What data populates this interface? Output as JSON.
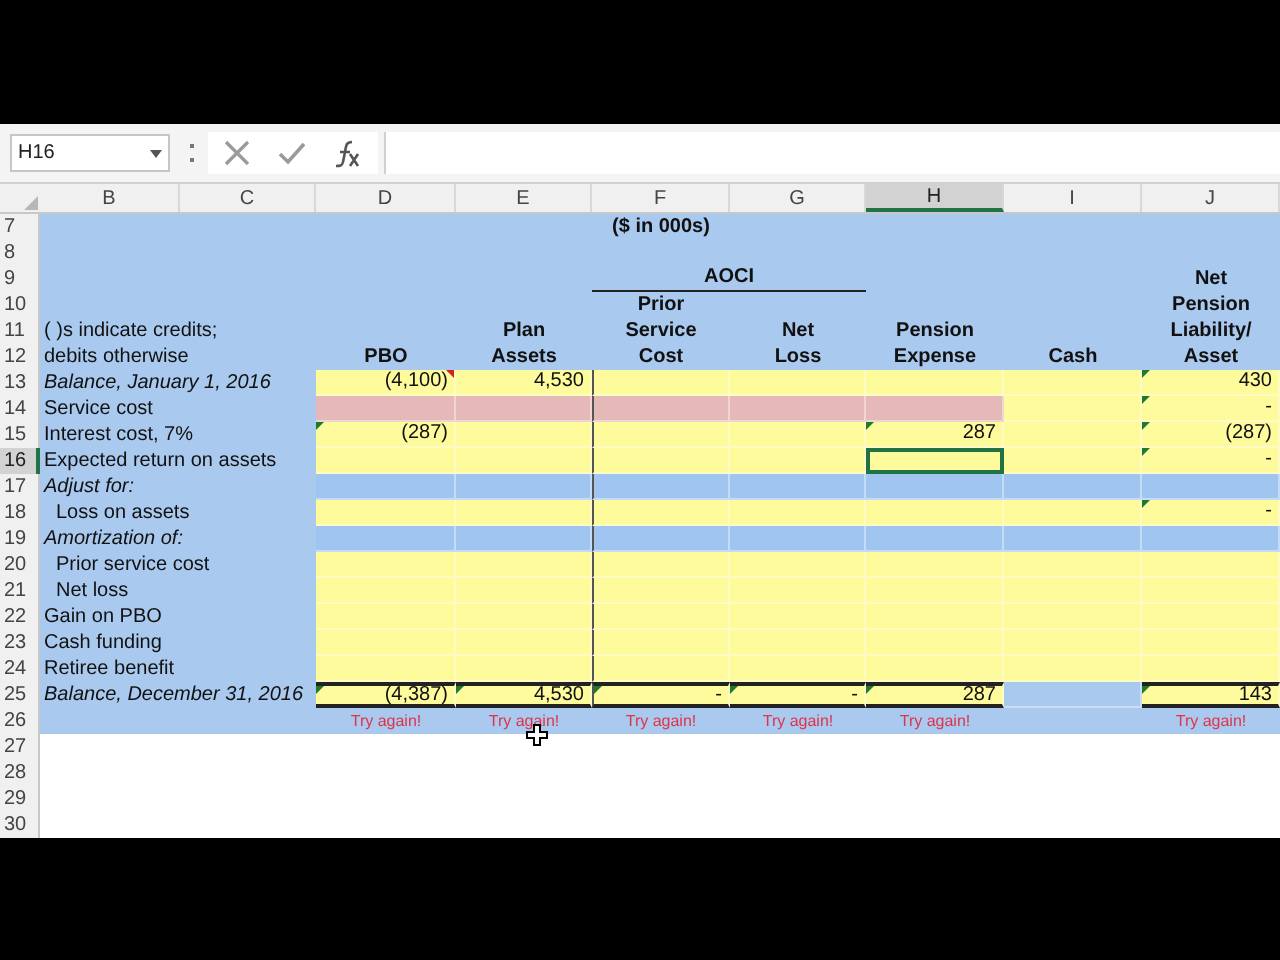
{
  "formula_bar": {
    "name_box": "H16"
  },
  "columns": [
    {
      "letter": "B",
      "selected": false
    },
    {
      "letter": "C",
      "selected": false
    },
    {
      "letter": "D",
      "selected": false
    },
    {
      "letter": "E",
      "selected": false
    },
    {
      "letter": "F",
      "selected": false
    },
    {
      "letter": "G",
      "selected": false
    },
    {
      "letter": "H",
      "selected": true
    },
    {
      "letter": "I",
      "selected": false
    },
    {
      "letter": "J",
      "selected": false
    }
  ],
  "rows": [
    {
      "number": "7",
      "kind": "heading",
      "selected": false,
      "cells": [
        null,
        null,
        {
          "text": "($ in 000s)"
        },
        null,
        null,
        null,
        null
      ]
    },
    {
      "number": "8",
      "kind": "heading",
      "selected": false,
      "cells": [
        null,
        null,
        null,
        null,
        null,
        null,
        null
      ]
    },
    {
      "number": "9",
      "kind": "heading",
      "selected": false,
      "group_heading": {
        "text": "AOCI",
        "underlined": true
      },
      "cells": [
        null,
        null,
        null,
        null,
        null,
        null,
        {
          "text": "Net"
        }
      ]
    },
    {
      "number": "10",
      "kind": "heading",
      "selected": false,
      "cells": [
        null,
        null,
        {
          "text": "Prior"
        },
        null,
        null,
        null,
        {
          "text": "Pension"
        }
      ]
    },
    {
      "number": "11",
      "kind": "heading",
      "selected": false,
      "label": "( )s indicate credits;",
      "cells": [
        null,
        {
          "text": "Plan"
        },
        {
          "text": "Service"
        },
        {
          "text": "Net"
        },
        {
          "text": "Pension"
        },
        null,
        {
          "text": "Liability/"
        }
      ]
    },
    {
      "number": "12",
      "kind": "heading",
      "selected": false,
      "label": "debits otherwise",
      "cells": [
        {
          "text": "PBO"
        },
        {
          "text": "Assets"
        },
        {
          "text": "Cost"
        },
        {
          "text": "Loss"
        },
        {
          "text": "Expense"
        },
        {
          "text": "Cash"
        },
        {
          "text": "Asset"
        }
      ]
    },
    {
      "number": "13",
      "kind": "entry",
      "selected": false,
      "label": "Balance, January 1, 2016",
      "italic": true,
      "indented": false,
      "cells": [
        {
          "text": "(4,100)",
          "color": "#fdfb9c",
          "error_mark": false,
          "comment_mark": true
        },
        {
          "text": "4,530",
          "color": "#fdfb9c",
          "error_mark": false,
          "comment_mark": false
        },
        {
          "color": "#fdfb9c",
          "error_mark": false,
          "comment_mark": false
        },
        {
          "color": "#fdfb9c",
          "error_mark": false,
          "comment_mark": false
        },
        {
          "color": "#fdfb9c",
          "error_mark": false,
          "comment_mark": false
        },
        {
          "color": "#fdfb9c",
          "error_mark": false,
          "comment_mark": false
        },
        {
          "text": "430",
          "color": "#fdfb9c",
          "error_mark": true,
          "comment_mark": false
        }
      ]
    },
    {
      "number": "14",
      "kind": "entry",
      "selected": false,
      "label": "Service cost",
      "italic": false,
      "indented": false,
      "cells": [
        {
          "color": "#e5b9b8",
          "error_mark": false,
          "comment_mark": false
        },
        {
          "color": "#e5b9b8",
          "error_mark": false,
          "comment_mark": false
        },
        {
          "color": "#e5b9b8",
          "error_mark": false,
          "comment_mark": false
        },
        {
          "color": "#e5b9b8",
          "error_mark": false,
          "comment_mark": false
        },
        {
          "color": "#e5b9b8",
          "error_mark": false,
          "comment_mark": false
        },
        {
          "color": "#fdfb9c",
          "error_mark": false,
          "comment_mark": false
        },
        {
          "text": "-",
          "color": "#fdfb9c",
          "error_mark": true,
          "comment_mark": false
        }
      ]
    },
    {
      "number": "15",
      "kind": "entry",
      "selected": false,
      "label": "Interest cost, 7%",
      "italic": false,
      "indented": false,
      "cells": [
        {
          "text": "(287)",
          "color": "#fdfb9c",
          "error_mark": true,
          "comment_mark": false
        },
        {
          "color": "#fdfb9c",
          "error_mark": false,
          "comment_mark": false
        },
        {
          "color": "#fdfb9c",
          "error_mark": false,
          "comment_mark": false
        },
        {
          "color": "#fdfb9c",
          "error_mark": false,
          "comment_mark": false
        },
        {
          "text": "287",
          "color": "#fdfb9c",
          "error_mark": true,
          "comment_mark": false
        },
        {
          "color": "#fdfb9c",
          "error_mark": false,
          "comment_mark": false
        },
        {
          "text": "(287)",
          "color": "#fdfb9c",
          "error_mark": true,
          "comment_mark": false
        }
      ]
    },
    {
      "number": "16",
      "kind": "entry",
      "selected": true,
      "label": "Expected return on assets",
      "italic": false,
      "indented": false,
      "cells": [
        {
          "color": "#fdfb9c",
          "error_mark": false,
          "comment_mark": false
        },
        {
          "color": "#fdfb9c",
          "error_mark": false,
          "comment_mark": false
        },
        {
          "color": "#fdfb9c",
          "error_mark": false,
          "comment_mark": false
        },
        {
          "color": "#fdfb9c",
          "error_mark": false,
          "comment_mark": false
        },
        {
          "color": "#fdfb9c",
          "error_mark": false,
          "comment_mark": false
        },
        {
          "color": "#fdfb9c",
          "error_mark": false,
          "comment_mark": false
        },
        {
          "text": "-",
          "color": "#fdfb9c",
          "error_mark": true,
          "comment_mark": false
        }
      ]
    },
    {
      "number": "17",
      "kind": "entry",
      "selected": false,
      "label": "Adjust for:",
      "italic": true,
      "indented": false,
      "cells": [
        {
          "color": "#9fc5f0",
          "error_mark": false,
          "comment_mark": false
        },
        {
          "color": "#9fc5f0",
          "error_mark": false,
          "comment_mark": false
        },
        {
          "color": "#9fc5f0",
          "error_mark": false,
          "comment_mark": false
        },
        {
          "color": "#9fc5f0",
          "error_mark": false,
          "comment_mark": false
        },
        {
          "color": "#9fc5f0",
          "error_mark": false,
          "comment_mark": false
        },
        {
          "color": "#9fc5f0",
          "error_mark": false,
          "comment_mark": false
        },
        {
          "color": "#9fc5f0",
          "error_mark": false,
          "comment_mark": false
        }
      ]
    },
    {
      "number": "18",
      "kind": "entry",
      "selected": false,
      "label": "Loss on assets",
      "italic": false,
      "indented": true,
      "cells": [
        {
          "color": "#fdfb9c",
          "error_mark": false,
          "comment_mark": false
        },
        {
          "color": "#fdfb9c",
          "error_mark": false,
          "comment_mark": false
        },
        {
          "color": "#fdfb9c",
          "error_mark": false,
          "comment_mark": false
        },
        {
          "color": "#fdfb9c",
          "error_mark": false,
          "comment_mark": false
        },
        {
          "color": "#fdfb9c",
          "error_mark": false,
          "comment_mark": false
        },
        {
          "color": "#fdfb9c",
          "error_mark": false,
          "comment_mark": false
        },
        {
          "text": "-",
          "color": "#fdfb9c",
          "error_mark": true,
          "comment_mark": false
        }
      ]
    },
    {
      "number": "19",
      "kind": "entry",
      "selected": false,
      "label": "Amortization of:",
      "italic": true,
      "indented": false,
      "cells": [
        {
          "color": "#9fc5f0",
          "error_mark": false,
          "comment_mark": false
        },
        {
          "color": "#9fc5f0",
          "error_mark": false,
          "comment_mark": false
        },
        {
          "color": "#9fc5f0",
          "error_mark": false,
          "comment_mark": false
        },
        {
          "color": "#9fc5f0",
          "error_mark": false,
          "comment_mark": false
        },
        {
          "color": "#9fc5f0",
          "error_mark": false,
          "comment_mark": false
        },
        {
          "color": "#9fc5f0",
          "error_mark": false,
          "comment_mark": false
        },
        {
          "color": "#9fc5f0",
          "error_mark": false,
          "comment_mark": false
        }
      ]
    },
    {
      "number": "20",
      "kind": "entry",
      "selected": false,
      "label": "Prior service cost",
      "italic": false,
      "indented": true,
      "cells": [
        {
          "color": "#fdfb9c",
          "error_mark": false,
          "comment_mark": false
        },
        {
          "color": "#fdfb9c",
          "error_mark": false,
          "comment_mark": false
        },
        {
          "color": "#fdfb9c",
          "error_mark": false,
          "comment_mark": false
        },
        {
          "color": "#fdfb9c",
          "error_mark": false,
          "comment_mark": false
        },
        {
          "color": "#fdfb9c",
          "error_mark": false,
          "comment_mark": false
        },
        {
          "color": "#fdfb9c",
          "error_mark": false,
          "comment_mark": false
        },
        {
          "color": "#fdfb9c",
          "error_mark": false,
          "comment_mark": false
        }
      ]
    },
    {
      "number": "21",
      "kind": "entry",
      "selected": false,
      "label": "Net loss",
      "italic": false,
      "indented": true,
      "cells": [
        {
          "color": "#fdfb9c",
          "error_mark": false,
          "comment_mark": false
        },
        {
          "color": "#fdfb9c",
          "error_mark": false,
          "comment_mark": false
        },
        {
          "color": "#fdfb9c",
          "error_mark": false,
          "comment_mark": false
        },
        {
          "color": "#fdfb9c",
          "error_mark": false,
          "comment_mark": false
        },
        {
          "color": "#fdfb9c",
          "error_mark": false,
          "comment_mark": false
        },
        {
          "color": "#fdfb9c",
          "error_mark": false,
          "comment_mark": false
        },
        {
          "color": "#fdfb9c",
          "error_mark": false,
          "comment_mark": false
        }
      ]
    },
    {
      "number": "22",
      "kind": "entry",
      "selected": false,
      "label": "Gain on PBO",
      "italic": false,
      "indented": false,
      "cells": [
        {
          "color": "#fdfb9c",
          "error_mark": false,
          "comment_mark": false
        },
        {
          "color": "#fdfb9c",
          "error_mark": false,
          "comment_mark": false
        },
        {
          "color": "#fdfb9c",
          "error_mark": false,
          "comment_mark": false
        },
        {
          "color": "#fdfb9c",
          "error_mark": false,
          "comment_mark": false
        },
        {
          "color": "#fdfb9c",
          "error_mark": false,
          "comment_mark": false
        },
        {
          "color": "#fdfb9c",
          "error_mark": false,
          "comment_mark": false
        },
        {
          "color": "#fdfb9c",
          "error_mark": false,
          "comment_mark": false
        }
      ]
    },
    {
      "number": "23",
      "kind": "entry",
      "selected": false,
      "label": "Cash funding",
      "italic": false,
      "indented": false,
      "cells": [
        {
          "color": "#fdfb9c",
          "error_mark": false,
          "comment_mark": false
        },
        {
          "color": "#fdfb9c",
          "error_mark": false,
          "comment_mark": false
        },
        {
          "color": "#fdfb9c",
          "error_mark": false,
          "comment_mark": false
        },
        {
          "color": "#fdfb9c",
          "error_mark": false,
          "comment_mark": false
        },
        {
          "color": "#fdfb9c",
          "error_mark": false,
          "comment_mark": false
        },
        {
          "color": "#fdfb9c",
          "error_mark": false,
          "comment_mark": false
        },
        {
          "color": "#fdfb9c",
          "error_mark": false,
          "comment_mark": false
        }
      ]
    },
    {
      "number": "24",
      "kind": "entry",
      "selected": false,
      "label": "Retiree benefit",
      "italic": false,
      "indented": false,
      "cells": [
        {
          "color": "#fdfb9c",
          "error_mark": false,
          "comment_mark": false
        },
        {
          "color": "#fdfb9c",
          "error_mark": false,
          "comment_mark": false
        },
        {
          "color": "#fdfb9c",
          "error_mark": false,
          "comment_mark": false
        },
        {
          "color": "#fdfb9c",
          "error_mark": false,
          "comment_mark": false
        },
        {
          "color": "#fdfb9c",
          "error_mark": false,
          "comment_mark": false
        },
        {
          "color": "#fdfb9c",
          "error_mark": false,
          "comment_mark": false
        },
        {
          "color": "#fdfb9c",
          "error_mark": false,
          "comment_mark": false
        }
      ]
    },
    {
      "number": "25",
      "kind": "total",
      "selected": false,
      "label": "Balance, December 31, 2016",
      "italic": true,
      "indented": false,
      "cells": [
        {
          "text": "(4,387)",
          "color": "#fdfb9c",
          "error_mark": true,
          "comment_mark": false
        },
        {
          "text": "4,530",
          "color": "#fdfb9c",
          "error_mark": true,
          "comment_mark": false
        },
        {
          "text": "-",
          "color": "#fdfb9c",
          "error_mark": true,
          "comment_mark": false
        },
        {
          "text": "-",
          "color": "#fdfb9c",
          "error_mark": true,
          "comment_mark": false
        },
        {
          "text": "287",
          "color": "#fdfb9c",
          "error_mark": true,
          "comment_mark": false
        },
        {
          "color": "#a9c9ee",
          "error_mark": false,
          "comment_mark": false
        },
        {
          "text": "143",
          "color": "#fdfb9c",
          "error_mark": true,
          "comment_mark": false
        }
      ]
    },
    {
      "number": "26",
      "kind": "feedback",
      "selected": false,
      "cells": [
        {
          "text": "Try again!"
        },
        {
          "text": "Try again!"
        },
        {
          "text": "Try again!"
        },
        {
          "text": "Try again!"
        },
        {
          "text": "Try again!"
        },
        null,
        {
          "text": "Try again!"
        }
      ]
    },
    {
      "number": "27",
      "kind": "blank",
      "selected": false
    },
    {
      "number": "28",
      "kind": "blank",
      "selected": false
    },
    {
      "number": "29",
      "kind": "blank",
      "selected": false
    },
    {
      "number": "30",
      "kind": "blank",
      "selected": false
    }
  ]
}
